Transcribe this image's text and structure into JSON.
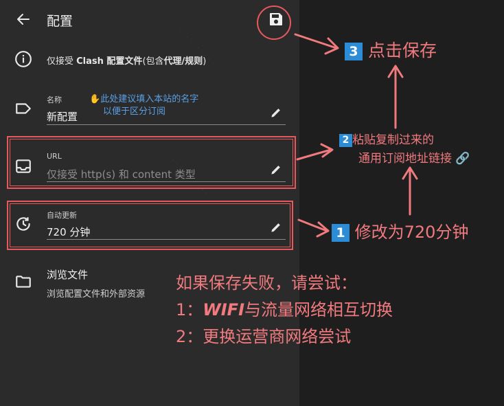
{
  "header": {
    "title": "配置",
    "back_icon": "arrow-left-icon",
    "save_icon": "floppy-disk-icon"
  },
  "info": {
    "prefix": "仅接受 ",
    "bold1": "Clash 配置文件",
    "middle": "(包含",
    "bold2": "代理/规则",
    "suffix": ")"
  },
  "name_field": {
    "label": "名称",
    "value": "新配置",
    "hint_line1": "此处建议填入本站的名字",
    "hint_line2": "以便于区分订阅"
  },
  "url_field": {
    "label": "URL",
    "placeholder": "仅接受 http(s) 和 content 类型"
  },
  "auto_update": {
    "label": "自动更新",
    "value": "720 分钟"
  },
  "browse": {
    "title": "浏览文件",
    "subtitle": "浏览配置文件和外部资源"
  },
  "annotations": {
    "step1_badge": "1",
    "step1_text": "修改为720分钟",
    "step2_badge": "2",
    "step2_line1": "粘贴复制过来的",
    "step2_line2": "通用订阅地址链接",
    "step3_badge": "3",
    "step3_text": "点击保存",
    "note_line1": "如果保存失败，请尝试：",
    "note_line2_prefix": "1：",
    "note_line2_ascii": "WIFI",
    "note_line2_rest": "与流量网络相互切换",
    "note_line3_prefix": "2：",
    "note_line3_rest": "更换运营商网络尝试"
  },
  "colors": {
    "annotation_red": "#f07a7e",
    "badge_blue": "#2d8cd6",
    "hint_blue": "#5aa0e6",
    "panel_bg": "#2b2b2b"
  }
}
